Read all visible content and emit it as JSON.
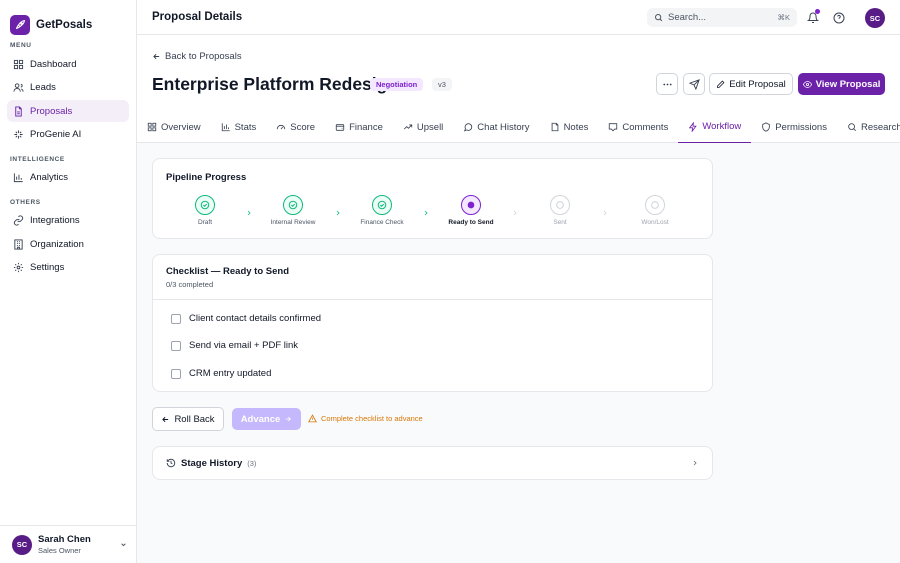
{
  "brand": {
    "name": "GetPosals"
  },
  "sidebar": {
    "menu_title": "MENU",
    "menu": [
      {
        "label": "Dashboard",
        "icon": "grid-icon",
        "active": false
      },
      {
        "label": "Leads",
        "icon": "users-icon",
        "active": false
      },
      {
        "label": "Proposals",
        "icon": "file-icon",
        "active": true
      },
      {
        "label": "ProGenie AI",
        "icon": "sparkle-icon",
        "active": false
      }
    ],
    "intel_title": "INTELLIGENCE",
    "intel": [
      {
        "label": "Analytics",
        "icon": "bar-chart-icon"
      }
    ],
    "others_title": "OTHERS",
    "others": [
      {
        "label": "Integrations",
        "icon": "link-icon"
      },
      {
        "label": "Organization",
        "icon": "building-icon"
      },
      {
        "label": "Settings",
        "icon": "gear-icon"
      }
    ],
    "user": {
      "initials": "SC",
      "name": "Sarah Chen",
      "role": "Sales Owner"
    }
  },
  "topbar": {
    "title": "Proposal Details",
    "search_placeholder": "Search...",
    "search_shortcut": "⌘K",
    "avatar_initials": "SC"
  },
  "header": {
    "back_label": "Back to Proposals",
    "title": "Enterprise Platform Redesign",
    "status_badge": "Negotiation",
    "version_badge": "v3",
    "edit_label": "Edit Proposal",
    "view_label": "View Proposal"
  },
  "tabs": [
    {
      "label": "Overview",
      "icon": "layout-icon"
    },
    {
      "label": "Stats",
      "icon": "bar-chart-icon"
    },
    {
      "label": "Score",
      "icon": "gauge-icon"
    },
    {
      "label": "Finance",
      "icon": "wallet-icon"
    },
    {
      "label": "Upsell",
      "icon": "trend-up-icon"
    },
    {
      "label": "Chat History",
      "icon": "chat-icon"
    },
    {
      "label": "Notes",
      "icon": "note-icon"
    },
    {
      "label": "Comments",
      "icon": "comment-icon"
    },
    {
      "label": "Workflow",
      "icon": "workflow-icon",
      "active": true
    },
    {
      "label": "Permissions",
      "icon": "shield-icon"
    },
    {
      "label": "Research",
      "icon": "search-icon"
    }
  ],
  "pipeline": {
    "title": "Pipeline Progress",
    "stages": [
      {
        "label": "Draft",
        "state": "done"
      },
      {
        "label": "Internal Review",
        "state": "done"
      },
      {
        "label": "Finance Check",
        "state": "done"
      },
      {
        "label": "Ready to Send",
        "state": "current"
      },
      {
        "label": "Sent",
        "state": "pending"
      },
      {
        "label": "Won/Lost",
        "state": "pending"
      }
    ]
  },
  "checklist": {
    "title": "Checklist — Ready to Send",
    "progress": "0/3 completed",
    "items": [
      {
        "label": "Client contact details confirmed",
        "checked": false
      },
      {
        "label": "Send via email + PDF link",
        "checked": false
      },
      {
        "label": "CRM entry updated",
        "checked": false
      }
    ]
  },
  "actions": {
    "rollback_label": "Roll Back",
    "advance_label": "Advance",
    "warning": "Complete checklist to advance"
  },
  "history": {
    "title": "Stage History",
    "count": "(3)"
  },
  "colors": {
    "brand": "#6b21a8",
    "success": "#10b981",
    "warning": "#d97706"
  }
}
